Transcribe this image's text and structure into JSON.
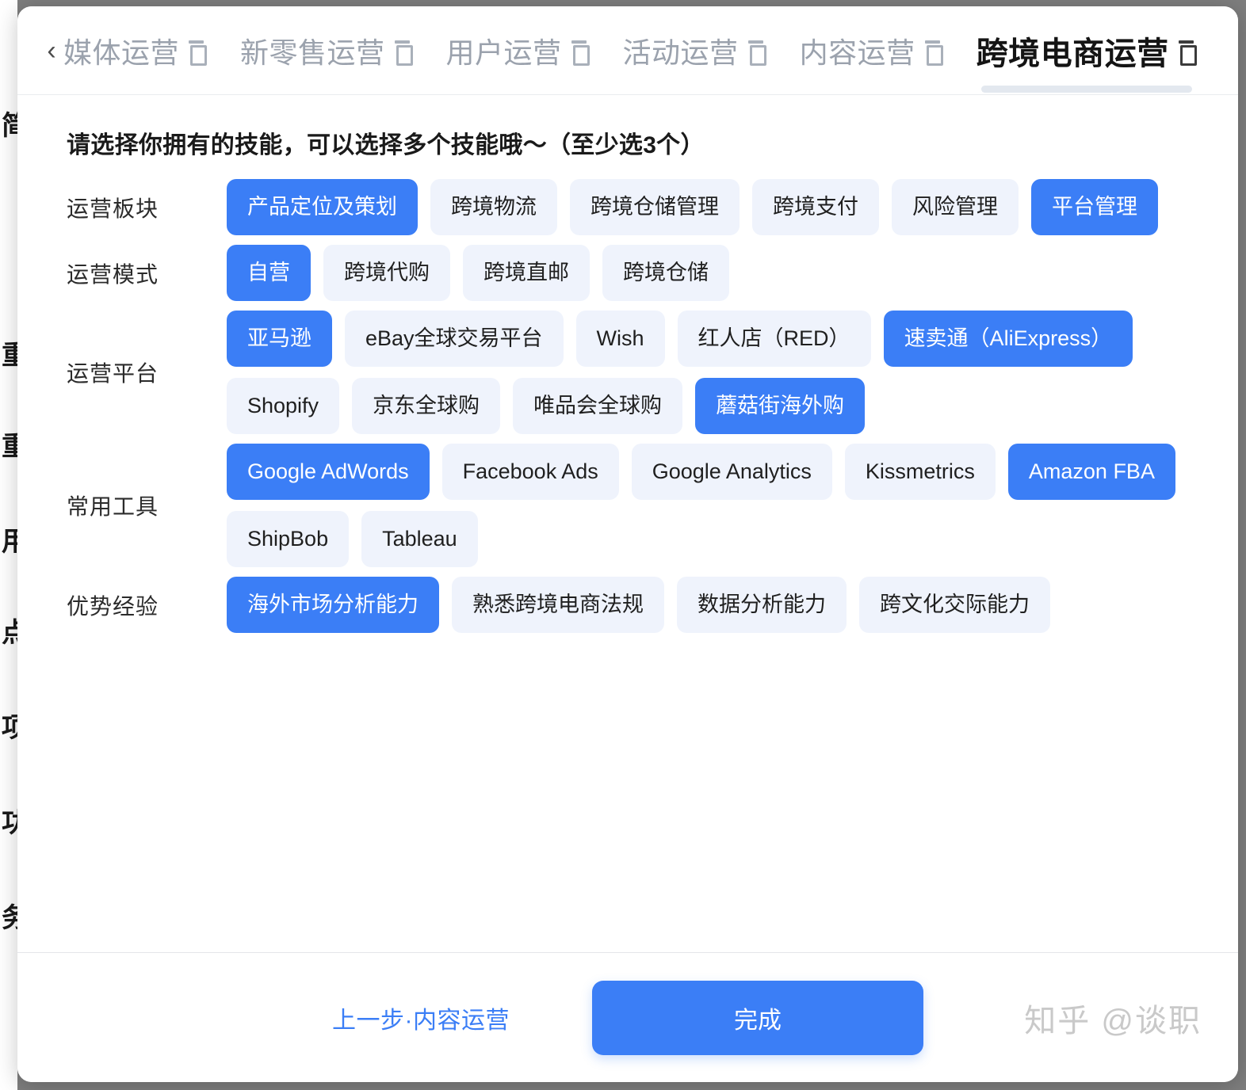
{
  "background_strip": {
    "lines": [
      "简",
      "重",
      "重",
      "用",
      "点",
      "项",
      "功",
      "务"
    ]
  },
  "tabbar": {
    "back_icon": "chevron-left-icon",
    "close_icon": "close-icon",
    "delete_icon": "trash-icon",
    "tabs": [
      {
        "label": "媒体运营",
        "active": false
      },
      {
        "label": "新零售运营",
        "active": false
      },
      {
        "label": "用户运营",
        "active": false
      },
      {
        "label": "活动运营",
        "active": false
      },
      {
        "label": "内容运营",
        "active": false
      },
      {
        "label": "跨境电商运营",
        "active": true
      }
    ]
  },
  "prompt": "请选择你拥有的技能，可以选择多个技能哦～（至少选3个）",
  "sections": [
    {
      "label": "运营板块",
      "tags": [
        {
          "text": "产品定位及策划",
          "selected": true
        },
        {
          "text": "跨境物流",
          "selected": false
        },
        {
          "text": "跨境仓储管理",
          "selected": false
        },
        {
          "text": "跨境支付",
          "selected": false
        },
        {
          "text": "风险管理",
          "selected": false
        },
        {
          "text": "平台管理",
          "selected": true
        }
      ]
    },
    {
      "label": "运营模式",
      "tags": [
        {
          "text": "自营",
          "selected": true
        },
        {
          "text": "跨境代购",
          "selected": false
        },
        {
          "text": "跨境直邮",
          "selected": false
        },
        {
          "text": "跨境仓储",
          "selected": false
        }
      ]
    },
    {
      "label": "运营平台",
      "tags": [
        {
          "text": "亚马逊",
          "selected": true
        },
        {
          "text": "eBay全球交易平台",
          "selected": false
        },
        {
          "text": "Wish",
          "selected": false
        },
        {
          "text": "红人店（RED）",
          "selected": false
        },
        {
          "text": "速卖通（AliExpress）",
          "selected": true
        },
        {
          "text": "Shopify",
          "selected": false
        },
        {
          "text": "京东全球购",
          "selected": false
        },
        {
          "text": "唯品会全球购",
          "selected": false
        },
        {
          "text": "蘑菇街海外购",
          "selected": true
        }
      ]
    },
    {
      "label": "常用工具",
      "tags": [
        {
          "text": "Google AdWords",
          "selected": true
        },
        {
          "text": "Facebook Ads",
          "selected": false
        },
        {
          "text": "Google Analytics",
          "selected": false
        },
        {
          "text": "Kissmetrics",
          "selected": false
        },
        {
          "text": "Amazon FBA",
          "selected": true
        },
        {
          "text": "ShipBob",
          "selected": false
        },
        {
          "text": "Tableau",
          "selected": false
        }
      ]
    },
    {
      "label": "优势经验",
      "tags": [
        {
          "text": "海外市场分析能力",
          "selected": true
        },
        {
          "text": "熟悉跨境电商法规",
          "selected": false
        },
        {
          "text": "数据分析能力",
          "selected": false
        },
        {
          "text": "跨文化交际能力",
          "selected": false
        }
      ]
    }
  ],
  "footer": {
    "prev_label": "上一步·内容运营",
    "finish_label": "完成",
    "watermark": "知乎 @谈职"
  },
  "colors": {
    "accent": "#3b7ef6",
    "tag_unselected_bg": "#eff3fc",
    "tag_selected_bg": "#3b7ef6",
    "tab_inactive_text": "#9ba2ad",
    "tab_active_text": "#141414",
    "backdrop": "#7e7e7e"
  }
}
